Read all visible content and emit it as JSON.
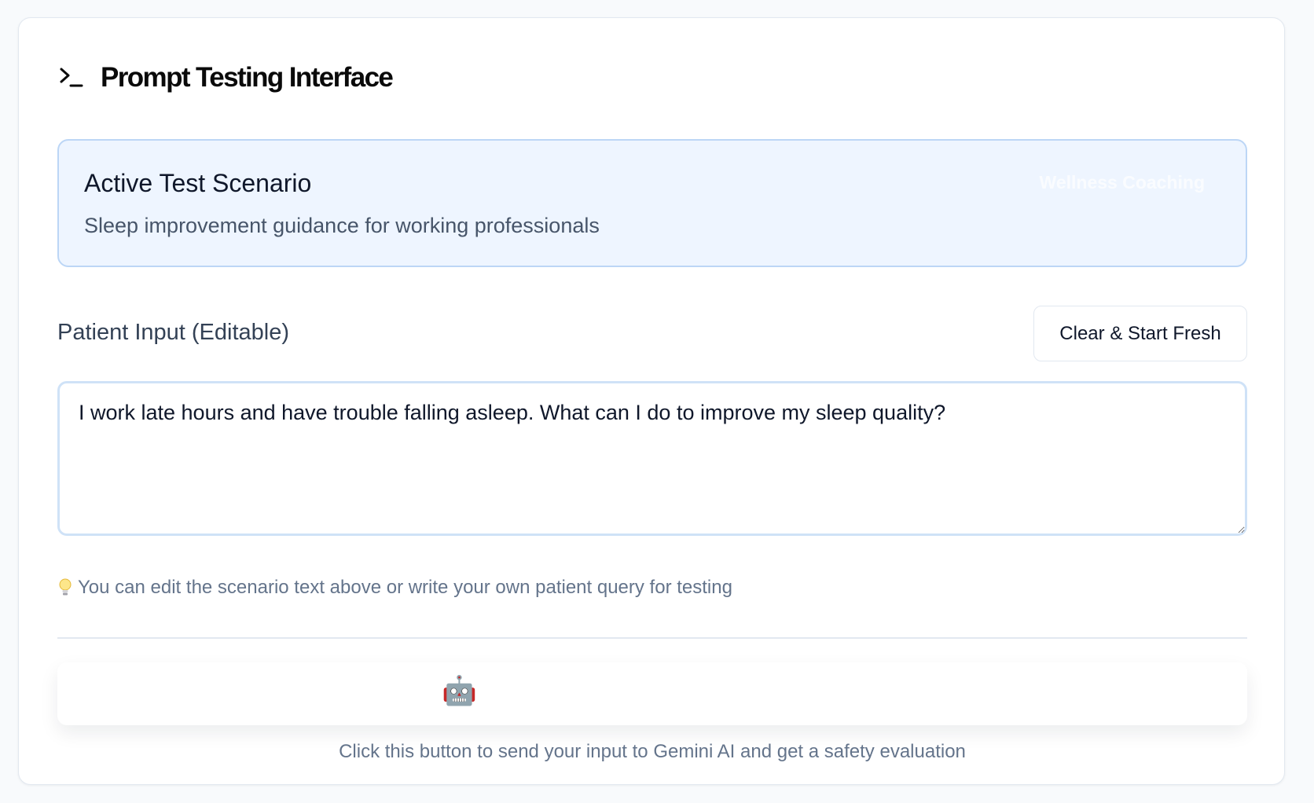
{
  "header": {
    "title": "Prompt Testing Interface",
    "icon": "terminal-icon"
  },
  "scenario": {
    "heading": "Active Test Scenario",
    "description": "Sleep improvement guidance for working professionals",
    "badge": "Wellness Coaching"
  },
  "patient_input": {
    "label": "Patient Input (Editable)",
    "value": "I work late hours and have trouble falling asleep. What can I do to improve my sleep quality?",
    "clear_button_label": "Clear & Start Fresh",
    "hint_icon": "lightbulb-icon",
    "hint": "You can edit the scenario text above or write your own patient query for testing"
  },
  "generate": {
    "icon": "robot-icon",
    "icon_glyph": "🤖",
    "hint": "Click this button to send your input to Gemini AI and get a safety evaluation"
  },
  "colors": {
    "accent_bg": "#eef5ff",
    "accent_border": "#bcd6f6",
    "muted_text": "#64748b"
  }
}
